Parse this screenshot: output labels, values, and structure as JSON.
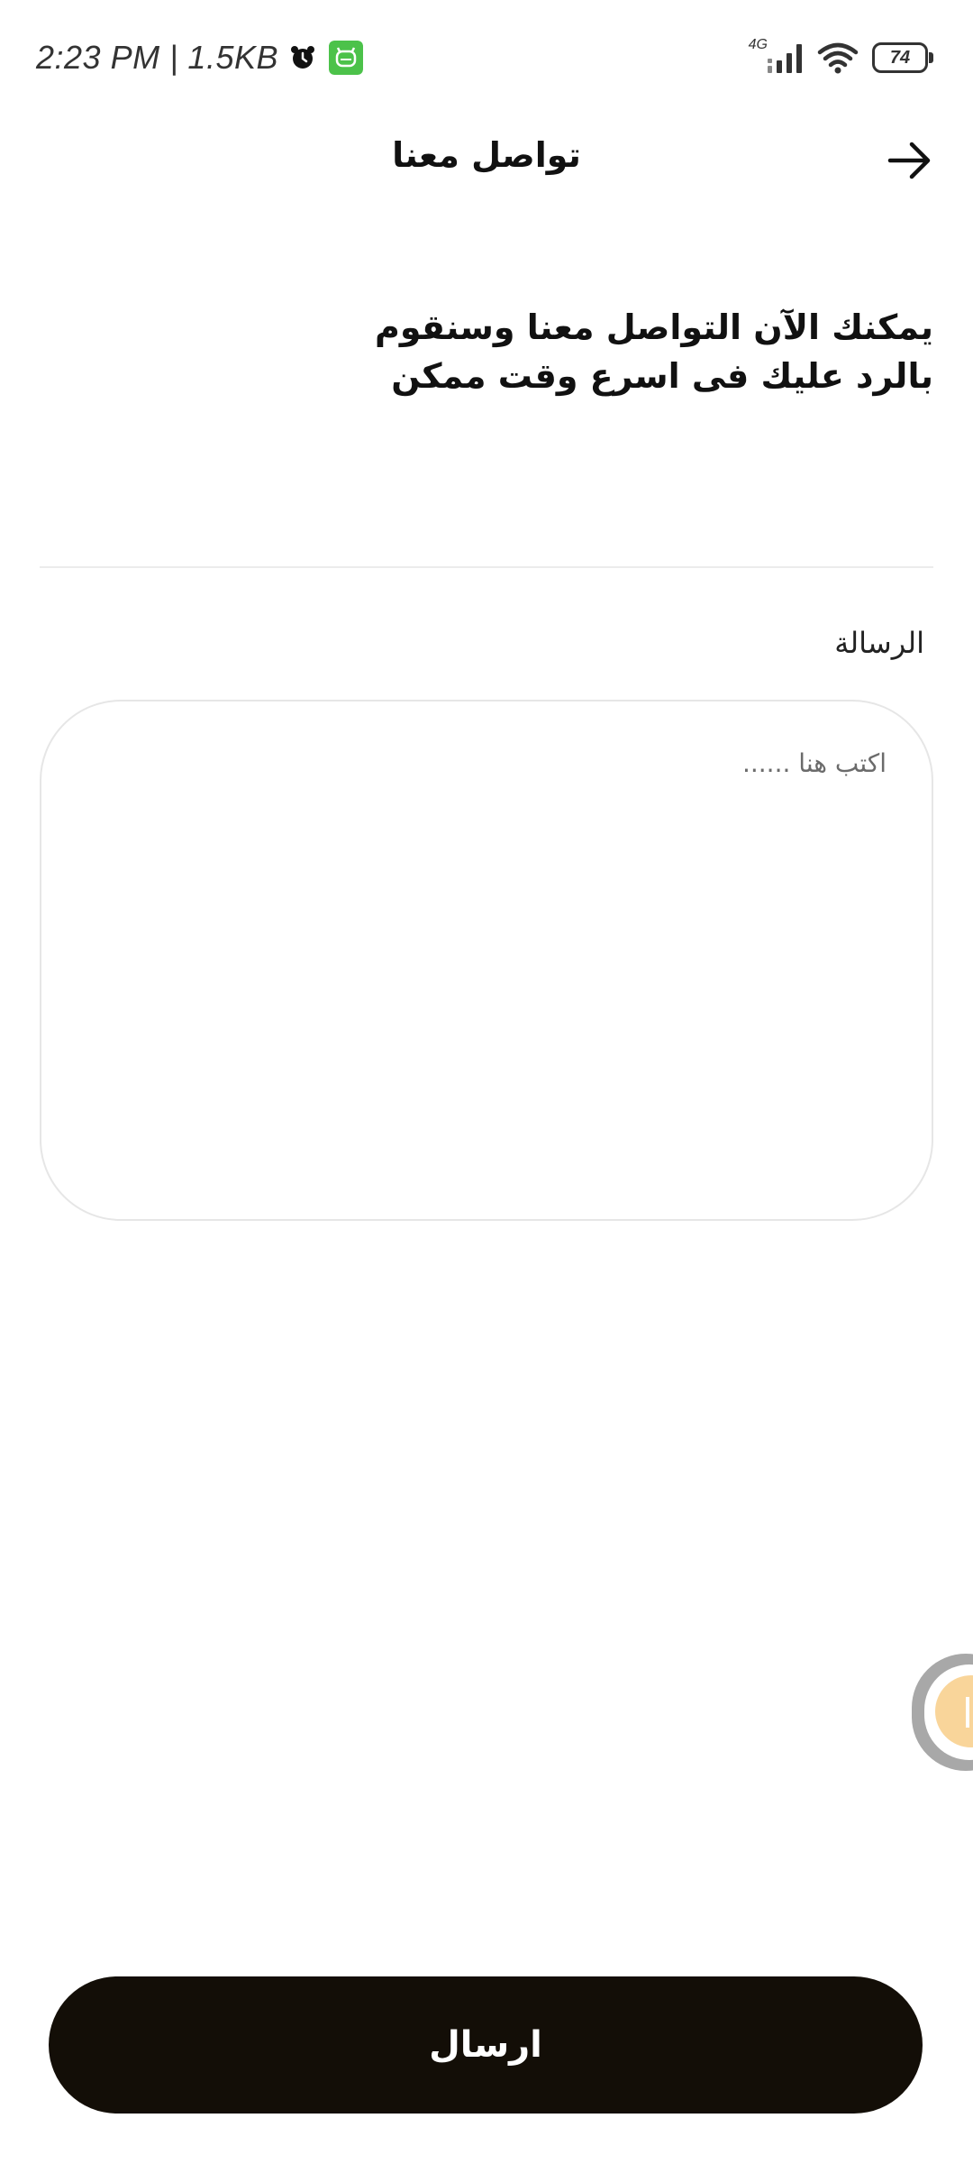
{
  "status_bar": {
    "time_data": "2:23 PM | 1.5KB",
    "network": "4G",
    "battery": "74",
    "icons": [
      "alarm-icon",
      "app-notification-icon",
      "signal-icon",
      "wifi-icon",
      "battery-icon"
    ]
  },
  "header": {
    "title": "تواصل معنا",
    "back_icon": "arrow-right-icon"
  },
  "intro": {
    "text": "يمكنك الآن التواصل معنا وسنقوم بالرد عليك فى اسرع وقت ممكن"
  },
  "form": {
    "message_label": "الرسالة",
    "message_value": "",
    "message_placeholder": "اكتب هنا ......"
  },
  "actions": {
    "send_label": "ارسال"
  },
  "colors": {
    "button_bg": "#130e07",
    "app_icon": "#4cc24a",
    "float_accent": "#f9d59a"
  }
}
